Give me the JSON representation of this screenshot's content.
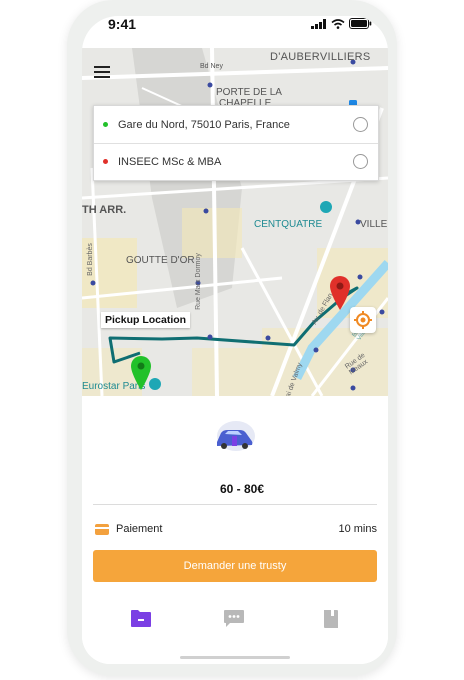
{
  "status_bar": {
    "time": "9:41"
  },
  "map": {
    "labels": {
      "aubervilliers": "D'AUBERVILLIERS",
      "bd_ney": "Bd Ney",
      "porte_chapelle_1": "PORTE DE LA",
      "porte_chapelle_2": "CHAPELLE",
      "arr": "TH ARR.",
      "centquatre": "CENTQUATRE",
      "villette": "VILLE",
      "goutte_dor": "GOUTTE D'OR",
      "bd_barbes": "Bd Barbès",
      "rue_marx_dormoy": "Rue Marx Dormoy",
      "av_flandre": "Av. de Flan...",
      "bassin": "Bassin de la Villette",
      "eurostar": "Eurostar Paris",
      "rue_valmy": "Quai de Valmy",
      "rue_meaux": "Rue de Meaux"
    }
  },
  "route": {
    "origin": "Gare du Nord, 75010 Paris, France",
    "destination": "INSEEC MSc & MBA",
    "origin_color": "#22c12a",
    "destination_color": "#e0302a",
    "pickup_label": "Pickup Location"
  },
  "trip": {
    "price": "60 - 80€",
    "payment_label": "Paiement",
    "eta": "10 mins",
    "request_button": "Demander une trusty"
  },
  "nav": {
    "items": [
      {
        "icon": "folder-icon",
        "active": true
      },
      {
        "icon": "chat-icon",
        "active": false
      },
      {
        "icon": "book-icon",
        "active": false
      }
    ],
    "active_color": "#7b3fe4",
    "inactive_color": "#b8b8b8"
  },
  "colors": {
    "accent": "#f5a53b",
    "route_line": "#0f6e72"
  }
}
